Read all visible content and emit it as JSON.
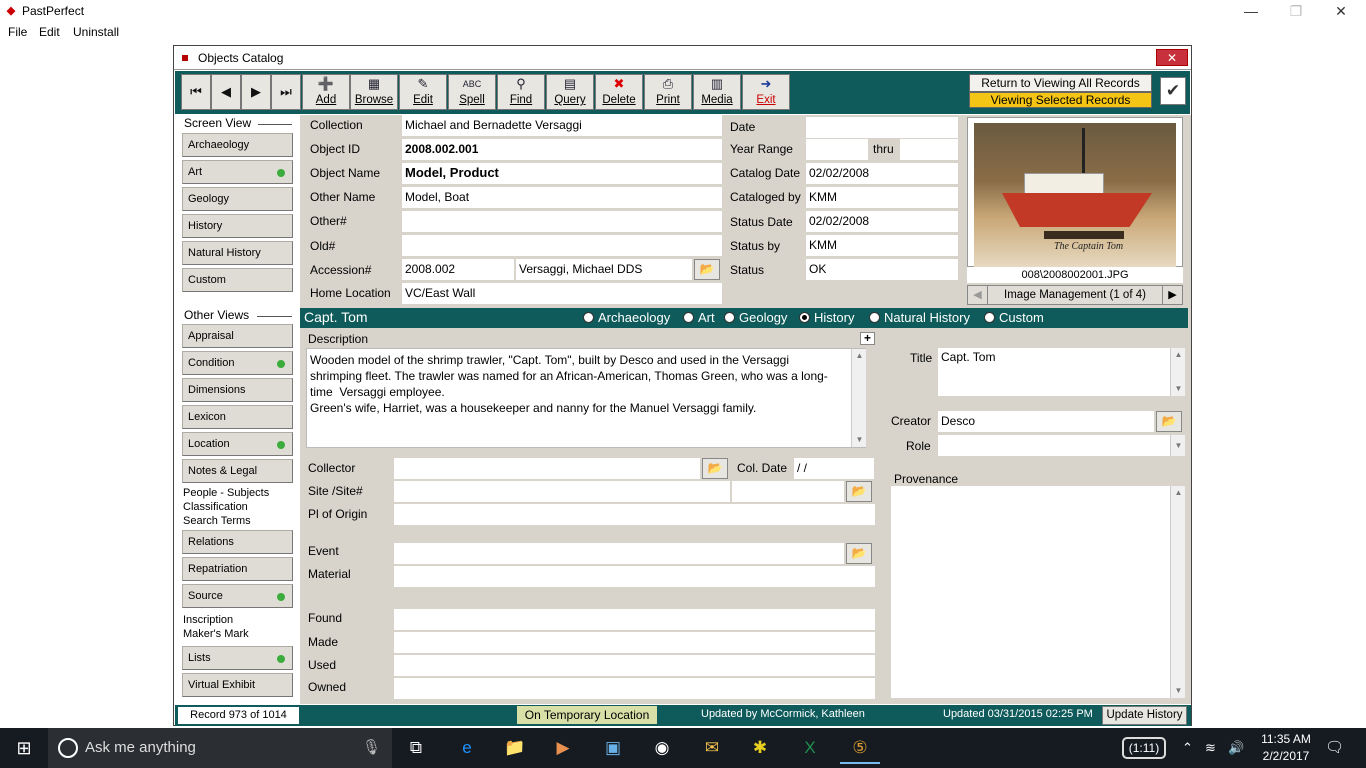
{
  "app": {
    "title": "PastPerfect",
    "menu": [
      "File",
      "Edit",
      "Uninstall"
    ]
  },
  "window": {
    "title": "Objects Catalog",
    "close_label": "✕"
  },
  "toolbar": {
    "nav": [
      "⏮",
      "◀",
      "▶",
      "⏭"
    ],
    "buttons": [
      {
        "label": "Add",
        "icon": "➕"
      },
      {
        "label": "Browse",
        "icon": "▦"
      },
      {
        "label": "Edit",
        "icon": "✎"
      },
      {
        "label": "Spell",
        "icon": "ABC"
      },
      {
        "label": "Find",
        "icon": "⚲"
      },
      {
        "label": "Query",
        "icon": "▤"
      },
      {
        "label": "Delete",
        "icon": "✖"
      },
      {
        "label": "Print",
        "icon": "⎙"
      },
      {
        "label": "Media",
        "icon": "▥"
      },
      {
        "label": "Exit",
        "icon": "➜"
      }
    ],
    "return_all": "Return to Viewing All Records",
    "viewing_selected": "Viewing Selected Records",
    "check_icon": "✔"
  },
  "screen_view": {
    "label": "Screen View",
    "items": [
      {
        "label": "Archaeology",
        "dot": false
      },
      {
        "label": "Art",
        "dot": true
      },
      {
        "label": "Geology",
        "dot": false
      },
      {
        "label": "History",
        "dot": false
      },
      {
        "label": "Natural History",
        "dot": false
      },
      {
        "label": "Custom",
        "dot": false
      }
    ]
  },
  "other_views": {
    "label": "Other Views",
    "items": [
      {
        "label": "Appraisal",
        "dot": false
      },
      {
        "label": "Condition",
        "dot": true
      },
      {
        "label": "Dimensions",
        "dot": false
      },
      {
        "label": "Lexicon",
        "dot": false
      },
      {
        "label": "Location",
        "dot": true
      },
      {
        "label": "Notes & Legal",
        "dot": false
      }
    ],
    "multi_1": [
      "People - Subjects",
      "Classification",
      "Search Terms"
    ],
    "items2": [
      {
        "label": "Relations",
        "dot": false
      },
      {
        "label": "Repatriation",
        "dot": false
      },
      {
        "label": "Source",
        "dot": true
      }
    ],
    "multi_2": [
      "Inscription",
      "Maker's Mark"
    ],
    "items3": [
      {
        "label": "Lists",
        "dot": true
      },
      {
        "label": "Virtual Exhibit",
        "dot": false
      }
    ]
  },
  "record": {
    "collection_label": "Collection",
    "collection": "Michael and Bernadette Versaggi",
    "object_id_label": "Object ID",
    "object_id": "2008.002.001",
    "object_name_label": "Object Name",
    "object_name": "Model, Product",
    "other_name_label": "Other Name",
    "other_name": "Model, Boat",
    "other_num_label": "Other#",
    "other_num": "",
    "old_num_label": "Old#",
    "old_num": "",
    "accession_label": "Accession#",
    "accession": "2008.002",
    "accession_name": "Versaggi, Michael DDS",
    "home_location_label": "Home Location",
    "home_location": "VC/East Wall",
    "date_label": "Date",
    "date": "",
    "year_range_label": "Year Range",
    "thru_label": "thru",
    "catalog_date_label": "Catalog Date",
    "catalog_date": "02/02/2008",
    "cataloged_by_label": "Cataloged by",
    "cataloged_by": "KMM",
    "status_date_label": "Status Date",
    "status_date": "02/02/2008",
    "status_by_label": "Status by",
    "status_by": "KMM",
    "status_label": "Status",
    "status": "OK"
  },
  "image": {
    "caption": "008\\2008002001.JPG",
    "management": "Image Management (1 of 4)",
    "prev": "◀",
    "next": "▶",
    "plaque_text": "The Captain Tom"
  },
  "history": {
    "title": "Capt. Tom",
    "radios": [
      {
        "label": "Archaeology",
        "selected": false
      },
      {
        "label": "Art",
        "selected": false
      },
      {
        "label": "Geology",
        "selected": false
      },
      {
        "label": "History",
        "selected": true
      },
      {
        "label": "Natural History",
        "selected": false
      },
      {
        "label": "Custom",
        "selected": false
      }
    ],
    "description_label": "Description",
    "description": "Wooden model of the shrimp trawler, \"Capt. Tom\", built by Desco and used in the Versaggi shrimping fleet. The trawler was named for an African-American, Thomas Green, who was a long-time  Versaggi employee.\nGreen's wife, Harriet, was a housekeeper and nanny for the Manuel Versaggi family.",
    "collector_label": "Collector",
    "collector": "",
    "col_date_label": "Col. Date",
    "col_date": " /  /",
    "site_label": "Site /Site#",
    "site": "",
    "site_num": "",
    "pl_origin_label": "Pl of Origin",
    "pl_origin": "",
    "event_label": "Event",
    "event": "",
    "material_label": "Material",
    "material": "",
    "found_label": "Found",
    "made_label": "Made",
    "used_label": "Used",
    "owned_label": "Owned",
    "title_label": "Title",
    "creator_label": "Creator",
    "creator": "Desco",
    "role_label": "Role",
    "role": "",
    "provenance_label": "Provenance",
    "provenance": ""
  },
  "statusbar": {
    "record": "Record 973 of 1014",
    "temp_location": "On Temporary Location",
    "updated_by": "Updated by   McCormick, Kathleen",
    "updated": "Updated    03/31/2015 02:25 PM",
    "update_history": "Update History"
  },
  "taskbar": {
    "search_placeholder": "Ask me anything",
    "tray_pill": "(1:11)",
    "time": "11:35 AM",
    "date": "2/2/2017"
  }
}
